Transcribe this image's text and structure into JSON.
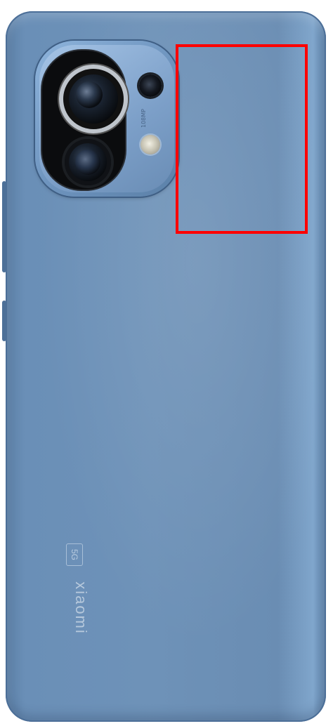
{
  "camera": {
    "spec_text": "108MP"
  },
  "branding": {
    "name": "xiaomi",
    "badge": "5G"
  },
  "annotation": {
    "highlight_color": "#ff0000"
  },
  "device_color": "#6a8eb5"
}
